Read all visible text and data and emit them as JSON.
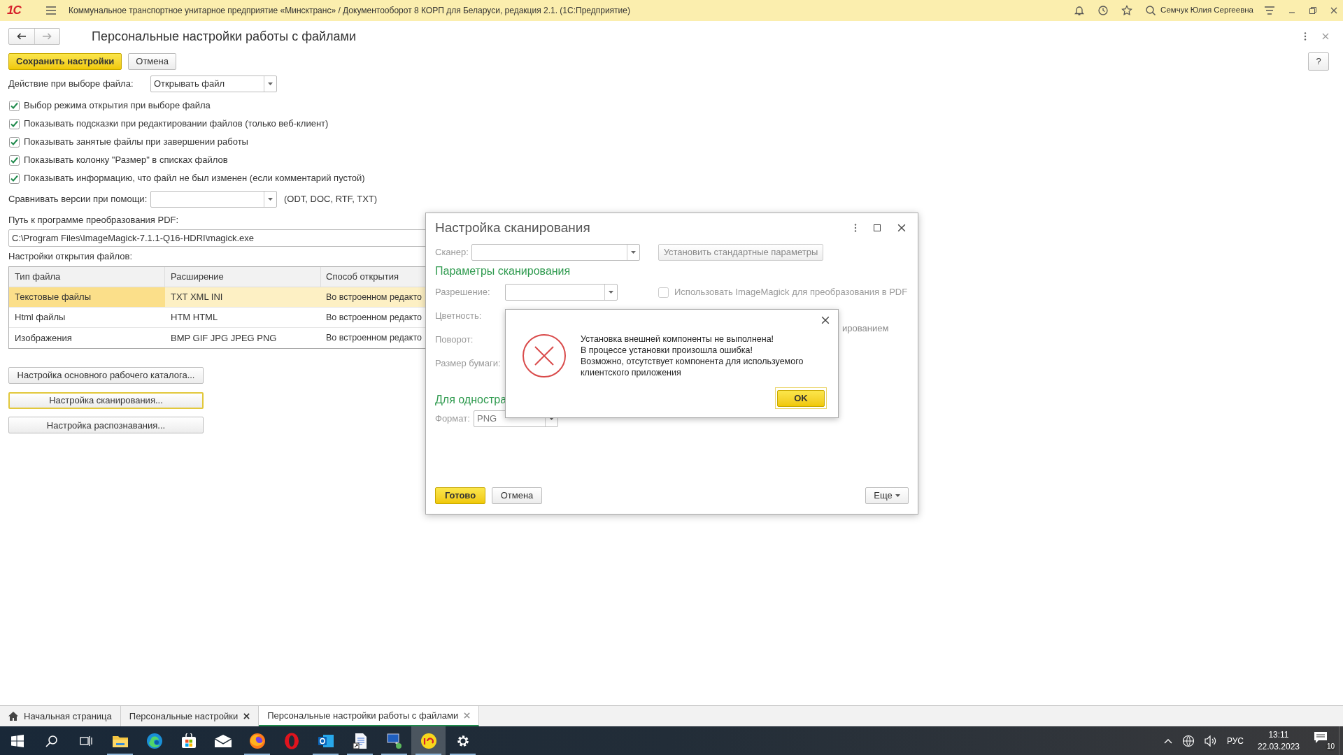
{
  "title_bar": {
    "logo": "1С",
    "title": "Коммунальное транспортное унитарное предприятие «Минсктранс» / Документооборот 8 КОРП для Беларуси, редакция 2.1. (1С:Предприятие)",
    "user": "Семчук Юлия Сергеевна"
  },
  "page": {
    "title": "Персональные настройки работы с файлами",
    "help": "?",
    "buttons": [
      {
        "label": "Сохранить настройки",
        "kind": "primary"
      },
      {
        "label": "Отмена",
        "kind": "normal"
      }
    ]
  },
  "file_action": {
    "label": "Действие при выборе файла:",
    "value": "Открывать файл"
  },
  "options": [
    {
      "label": "Выбор режима открытия при выборе файла",
      "checked": true
    },
    {
      "label": "Показывать подсказки при редактировании файлов (только веб-клиент)",
      "checked": true
    },
    {
      "label": "Показывать занятые файлы при завершении работы",
      "checked": true
    },
    {
      "label": "Показывать колонку \"Размер\" в списках файлов",
      "checked": true
    },
    {
      "label": "Показывать информацию, что файл не был изменен (если комментарий пустой)",
      "checked": true
    }
  ],
  "compare": {
    "label": "Сравнивать версии при помощи:",
    "hint": "(ODT, DOC, RTF, TXT)"
  },
  "pdf_path": {
    "label": "Путь к программе преобразования PDF:",
    "value": "C:\\Program Files\\ImageMagick-7.1.1-Q16-HDRI\\magick.exe"
  },
  "open_settings": {
    "label": "Настройки открытия файлов:",
    "columns": [
      "Тип файла",
      "Расширение",
      "Способ открытия"
    ],
    "rows": [
      {
        "cells": [
          "Текстовые файлы",
          "TXT XML INI",
          "Во встроенном редакто"
        ],
        "selected": true
      },
      {
        "cells": [
          "Html файлы",
          "HTM HTML",
          "Во встроенном редакто"
        ],
        "selected": false
      },
      {
        "cells": [
          "Изображения",
          "BMP GIF JPG JPEG PNG",
          "Во встроенном редакто"
        ],
        "selected": false
      }
    ]
  },
  "setting_buttons": [
    {
      "label": "Настройка основного рабочего каталога...",
      "focused": false
    },
    {
      "label": "Настройка сканирования...",
      "focused": true
    },
    {
      "label": "Настройка распознавания...",
      "focused": false
    }
  ],
  "scan_dialog": {
    "title": "Настройка сканирования",
    "scanner": {
      "label": "Сканер:",
      "disabled": true
    },
    "defaults_button": "Установить стандартные параметры",
    "section": "Параметры сканирования",
    "fields": [
      {
        "label": "Разрешение:",
        "kind": "combo"
      },
      {
        "label": "Цветность:",
        "kind": "label"
      },
      {
        "label": "Поворот:",
        "kind": "label"
      },
      {
        "label": "Размер бумаги:",
        "kind": "label"
      }
    ],
    "checkbox": {
      "label": "Использовать ImageMagick для преобразования в PDF",
      "checked": false,
      "disabled": true
    },
    "fragment": "ированием",
    "section_2": "Для одностра",
    "format": {
      "label": "Формат:",
      "value": "PNG",
      "disabled": true
    },
    "buttons": [
      {
        "label": "Готово",
        "kind": "primary"
      },
      {
        "label": "Отмена",
        "kind": "normal"
      }
    ],
    "more": "Еще"
  },
  "error_dialog": {
    "lines": [
      "Установка внешней компоненты не выполнена!",
      "В процессе установки произошла ошибка!",
      "Возможно, отсутствует компонента для используемого клиентского приложения"
    ],
    "button": "OK"
  },
  "tabs": [
    {
      "label": "Начальная страница",
      "kind": "home",
      "selected": false
    },
    {
      "label": "Персональные настройки",
      "kind": "closable",
      "selected": false
    },
    {
      "label": "Персональные настройки работы с файлами",
      "kind": "closable",
      "selected": true
    }
  ],
  "taskbar": {
    "apps": [
      {
        "kind": "windows",
        "running": false,
        "selected": false
      },
      {
        "kind": "search",
        "running": false,
        "selected": false
      },
      {
        "kind": "taskview",
        "running": false,
        "selected": false
      },
      {
        "kind": "folder",
        "running": true,
        "selected": false
      },
      {
        "kind": "edge",
        "running": false,
        "selected": false
      },
      {
        "kind": "store",
        "running": false,
        "selected": false
      },
      {
        "kind": "mail",
        "running": false,
        "selected": false
      },
      {
        "kind": "firefox",
        "running": true,
        "selected": false
      },
      {
        "kind": "opera",
        "running": false,
        "selected": false
      },
      {
        "kind": "outlook",
        "running": true,
        "selected": false
      },
      {
        "kind": "document",
        "running": true,
        "selected": false
      },
      {
        "kind": "network",
        "running": true,
        "selected": false
      },
      {
        "kind": "onec",
        "running": true,
        "selected": true
      },
      {
        "kind": "gear",
        "running": true,
        "selected": false
      }
    ],
    "language": "РУС",
    "time": "13:11",
    "date": "22.03.2023",
    "notifications": "10"
  }
}
